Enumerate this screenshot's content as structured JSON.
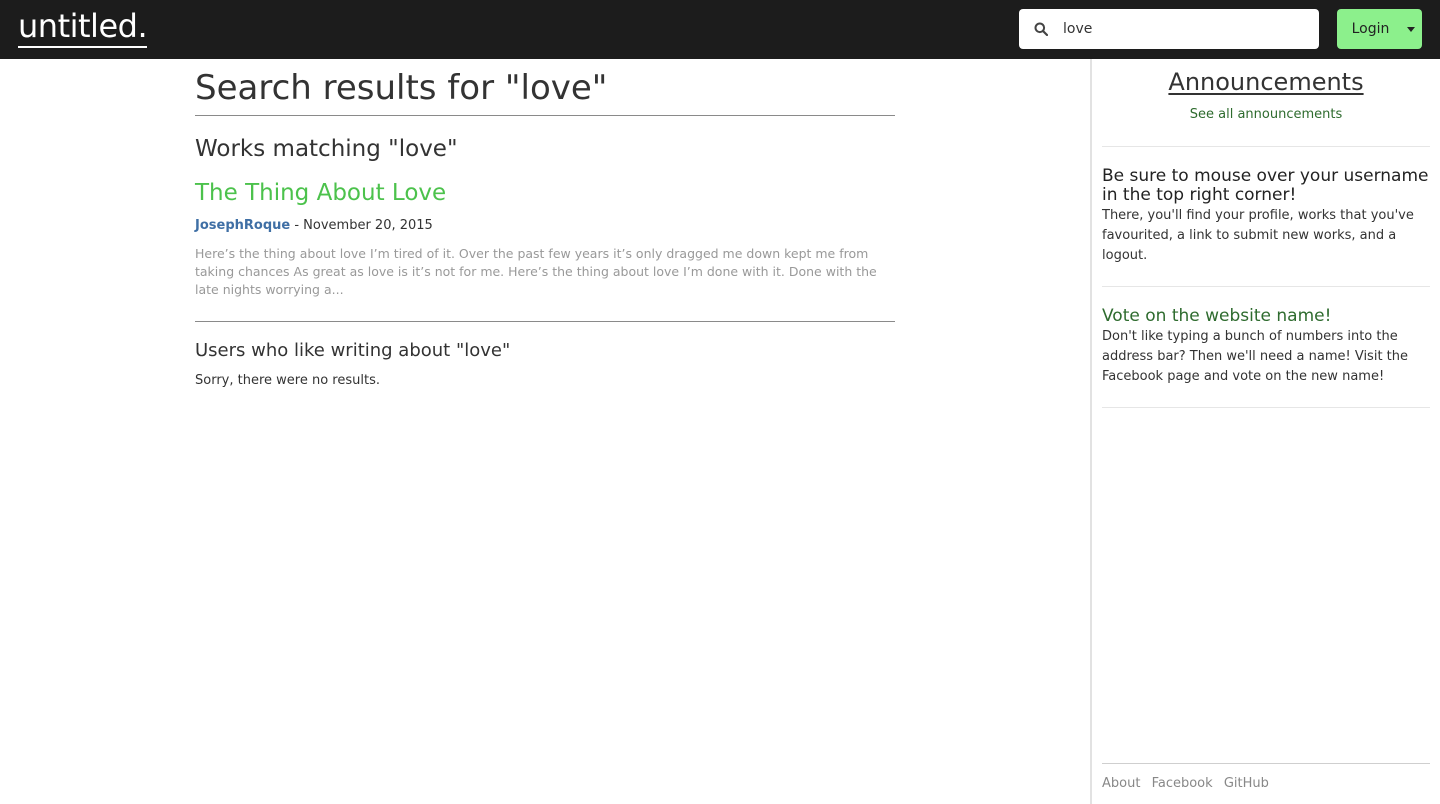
{
  "navbar": {
    "brand": "untitled.",
    "search": {
      "value": "love",
      "placeholder": ""
    },
    "login_label": "Login"
  },
  "main": {
    "page_title": "Search results for \"love\"",
    "works_heading": "Works matching \"love\"",
    "works": [
      {
        "title": "The Thing About Love",
        "author": "JosephRoque",
        "date_sep": " - ",
        "date": "November 20, 2015",
        "excerpt": "Here’s the thing about love I’m tired of it. Over the past few years it’s only dragged me down kept me from taking chances As great as love is it’s not for me. Here’s the thing about love I’m done with it. Done with the late nights worrying a..."
      }
    ],
    "users_heading": "Users who like writing about \"love\"",
    "users_empty": "Sorry, there were no results."
  },
  "sidebar": {
    "title": "Announcements",
    "see_all": "See all announcements",
    "announcements": [
      {
        "heading": "Be sure to mouse over your username in the top right corner!",
        "body": "There, you'll find your profile, works that you've favourited, a link to submit new works, and a logout."
      },
      {
        "heading": "Vote on the website name!",
        "body": "Don't like typing a bunch of numbers into the address bar? Then we'll need a name! Visit the Facebook page and vote on the new name!"
      }
    ],
    "footer": [
      "About",
      "Facebook",
      "GitHub"
    ]
  },
  "icons": {
    "search": "search-icon",
    "caret": "chevron-down-icon"
  },
  "colors": {
    "navbar_bg": "#1c1c1c",
    "login_bg": "#8cf08c",
    "work_title": "#4cc24c",
    "author_link": "#3f6fa5",
    "announcement_green": "#2e6b2e"
  }
}
